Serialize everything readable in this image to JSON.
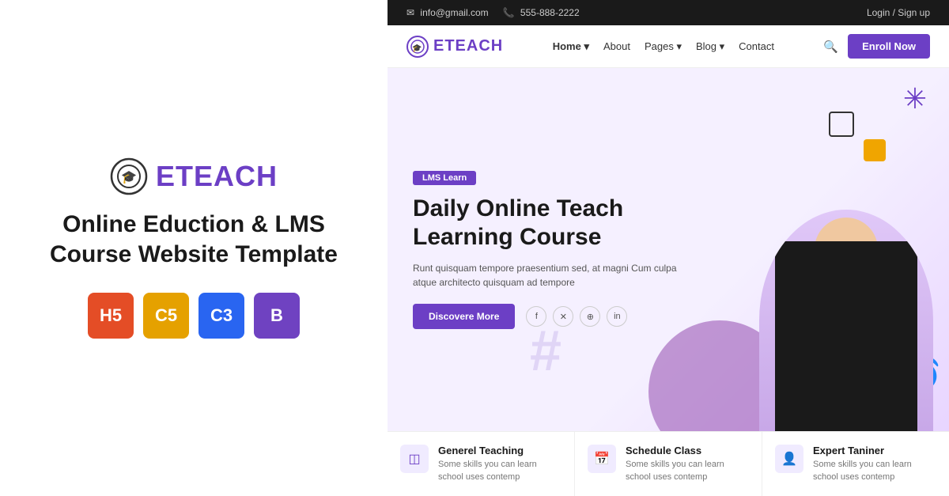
{
  "left": {
    "logo_text": "ETEACH",
    "tagline": "Online Eduction & LMS Course Website Template",
    "tech_icons": [
      {
        "label": "HTML5",
        "symbol": "5",
        "class": "badge-html"
      },
      {
        "label": "CSS5",
        "symbol": "5",
        "class": "badge-css"
      },
      {
        "label": "CSS3",
        "symbol": "3",
        "class": "badge-css3"
      },
      {
        "label": "Bootstrap",
        "symbol": "B",
        "class": "badge-bs"
      }
    ]
  },
  "topbar": {
    "email": "info@gmail.com",
    "phone": "555-888-2222",
    "auth": "Login / Sign up"
  },
  "nav": {
    "logo": "ETEACH",
    "links": [
      {
        "label": "Home",
        "has_dropdown": true
      },
      {
        "label": "About",
        "has_dropdown": false
      },
      {
        "label": "Pages",
        "has_dropdown": true
      },
      {
        "label": "Blog",
        "has_dropdown": true
      },
      {
        "label": "Contact",
        "has_dropdown": false
      }
    ],
    "enroll_label": "Enroll Now"
  },
  "hero": {
    "badge": "LMS Learn",
    "title": "Daily Online Teach\nLearning Course",
    "description": "Runt quisquam tempore praesentium sed, at magni Cum culpa atque architecto quisquam ad tempore",
    "cta_label": "Discovere More",
    "social": [
      "f",
      "𝕏",
      "●",
      "in"
    ]
  },
  "features": [
    {
      "icon": "◫",
      "title": "Generel Teaching",
      "desc": "Some skills you can learn school uses contemp"
    },
    {
      "icon": "📅",
      "title": "Schedule Class",
      "desc": "Some skills you can learn school uses contemp"
    },
    {
      "icon": "👤",
      "title": "Expert Taniner",
      "desc": "Some skills you can learn school uses contemp"
    }
  ]
}
